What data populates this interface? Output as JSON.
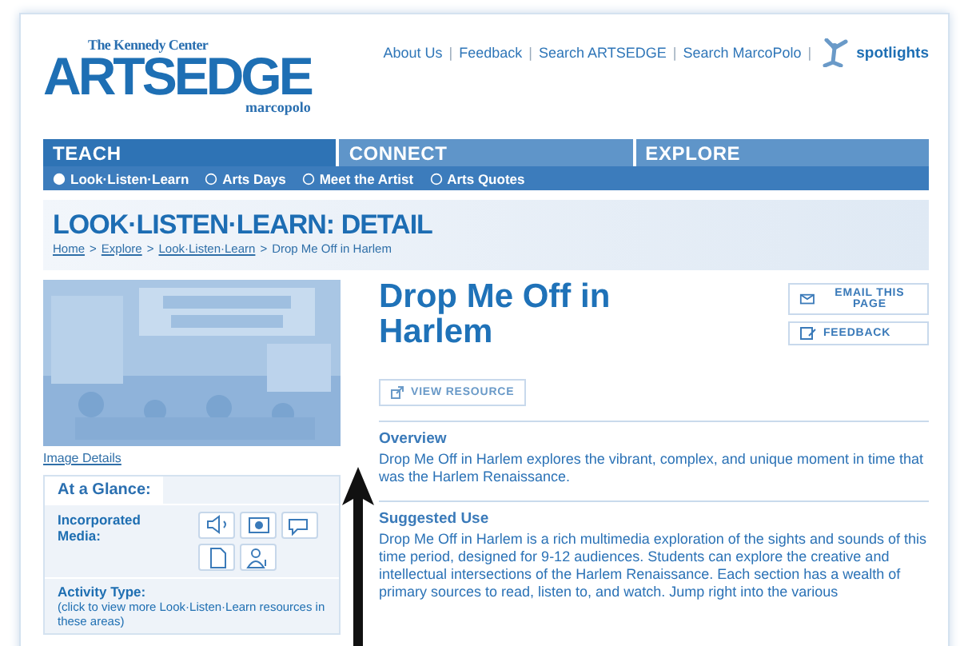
{
  "header": {
    "org": "The Kennedy Center",
    "logo": "ARTSEDGE",
    "sublogo": "marcopolo",
    "links": [
      "About Us",
      "Feedback",
      "Search ARTSEDGE",
      "Search MarcoPolo"
    ],
    "link_separator": "|",
    "spotlights": "spotlights"
  },
  "nav": {
    "tabs": [
      {
        "label": "TEACH",
        "selected": true
      },
      {
        "label": "CONNECT",
        "selected": false
      },
      {
        "label": "EXPLORE",
        "selected": false
      }
    ],
    "subnav": [
      {
        "label": "Look·Listen·Learn",
        "selected": true
      },
      {
        "label": "Arts Days",
        "selected": false
      },
      {
        "label": "Meet the Artist",
        "selected": false
      },
      {
        "label": "Arts Quotes",
        "selected": false
      }
    ]
  },
  "page_title": "LOOK·LISTEN·LEARN: DETAIL",
  "breadcrumb": [
    {
      "label": "Home",
      "link": true
    },
    {
      "label": "Explore",
      "link": true
    },
    {
      "label": "Look·Listen·Learn",
      "link": true
    },
    {
      "label": "Drop Me Off in Harlem",
      "link": false
    }
  ],
  "breadcrumb_separator": ">",
  "sidebar": {
    "image_link": "Image Details",
    "glance": {
      "title": "At a Glance:",
      "media_label": "Incorporated Media:",
      "activity_label": "Activity Type:",
      "activity_note": "(click to view more Look·Listen·Learn resources in these areas)"
    }
  },
  "detail": {
    "title": "Drop Me Off in Harlem",
    "actions": [
      {
        "kind": "email",
        "label": "EMAIL THIS PAGE"
      },
      {
        "kind": "feedback",
        "label": "FEEDBACK"
      }
    ],
    "view_resource": "VIEW RESOURCE",
    "sections": [
      {
        "heading": "Overview",
        "text": "Drop Me Off in Harlem explores the vibrant, complex, and unique moment in time that was the Harlem Renaissance."
      },
      {
        "heading": "Suggested Use",
        "text": "Drop Me Off in Harlem is a rich multimedia exploration of the sights and sounds of this time period, designed for 9-12 audiences. Students can explore the creative and intellectual intersections of the Harlem Renaissance. Each section has a wealth of primary sources to read, listen to, and watch. Jump right into the various"
      }
    ]
  }
}
